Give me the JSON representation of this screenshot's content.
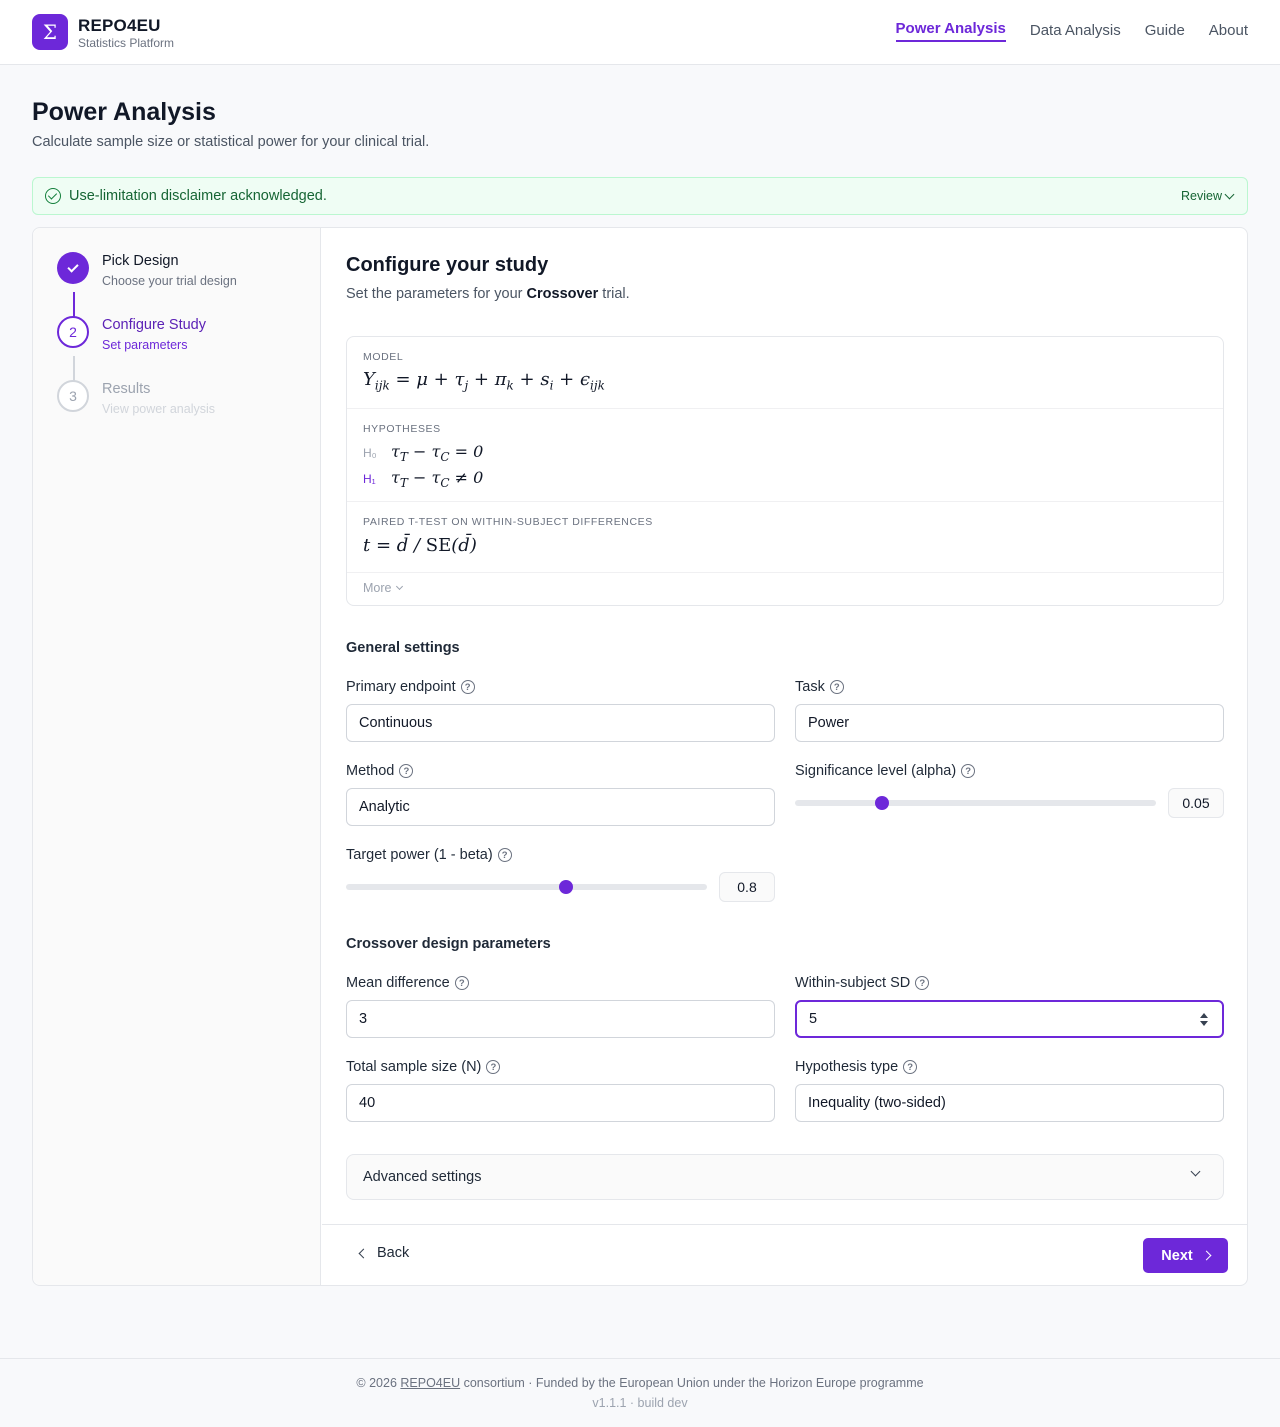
{
  "brand": {
    "title": "REPO4EU",
    "subtitle": "Statistics Platform",
    "logo_symbol": "Σ"
  },
  "nav": [
    {
      "label": "Power Analysis",
      "active": true
    },
    {
      "label": "Data Analysis"
    },
    {
      "label": "Guide"
    },
    {
      "label": "About"
    }
  ],
  "page": {
    "title": "Power Analysis",
    "subtitle": "Calculate sample size or statistical power for your clinical trial."
  },
  "banner": {
    "text": "Use-limitation disclaimer acknowledged.",
    "review_label": "Review"
  },
  "steps": [
    {
      "number": "1",
      "title": "Pick Design",
      "subtitle": "Choose your trial design",
      "state": "done"
    },
    {
      "number": "2",
      "title": "Configure Study",
      "subtitle": "Set parameters",
      "state": "active"
    },
    {
      "number": "3",
      "title": "Results",
      "subtitle": "View power analysis",
      "state": "pending"
    }
  ],
  "config": {
    "title": "Configure your study",
    "subtitle_pre": "Set the parameters for your ",
    "design": "Crossover",
    "subtitle_post": " trial."
  },
  "model": {
    "model_label": "MODEL",
    "hypotheses_label": "HYPOTHESES",
    "h0_label": "H₀",
    "h1_label": "H₁",
    "test_label": "PAIRED T-TEST ON WITHIN-SUBJECT DIFFERENCES",
    "more_label": "More"
  },
  "general": {
    "heading": "General settings",
    "primary_endpoint": {
      "label": "Primary endpoint",
      "value": "Continuous"
    },
    "task": {
      "label": "Task",
      "value": "Power"
    },
    "method": {
      "label": "Method",
      "value": "Analytic"
    },
    "alpha": {
      "label": "Significance level (alpha)",
      "value": "0.05",
      "fraction": 0.24
    },
    "power": {
      "label": "Target power (1 - beta)",
      "value": "0.8",
      "fraction": 0.61
    }
  },
  "crossover": {
    "heading": "Crossover design parameters",
    "mean_difference": {
      "label": "Mean difference",
      "value": "3"
    },
    "within_sd": {
      "label": "Within-subject SD",
      "value": "5"
    },
    "sample_size": {
      "label": "Total sample size (N)",
      "value": "40"
    },
    "hypothesis_type": {
      "label": "Hypothesis type",
      "value": "Inequality (two-sided)"
    }
  },
  "advanced": {
    "label": "Advanced settings"
  },
  "buttons": {
    "back": "Back",
    "next": "Next"
  },
  "footer": {
    "copyright_pre": "© 2026 ",
    "copyright_link": "REPO4EU",
    "copyright_post": " consortium · Funded by the European Union under the Horizon Europe programme",
    "version": "v1.1.1 · build dev"
  },
  "colors": {
    "accent": "#6d28d9",
    "success_bg": "#effdf4",
    "success_text": "#166534"
  }
}
